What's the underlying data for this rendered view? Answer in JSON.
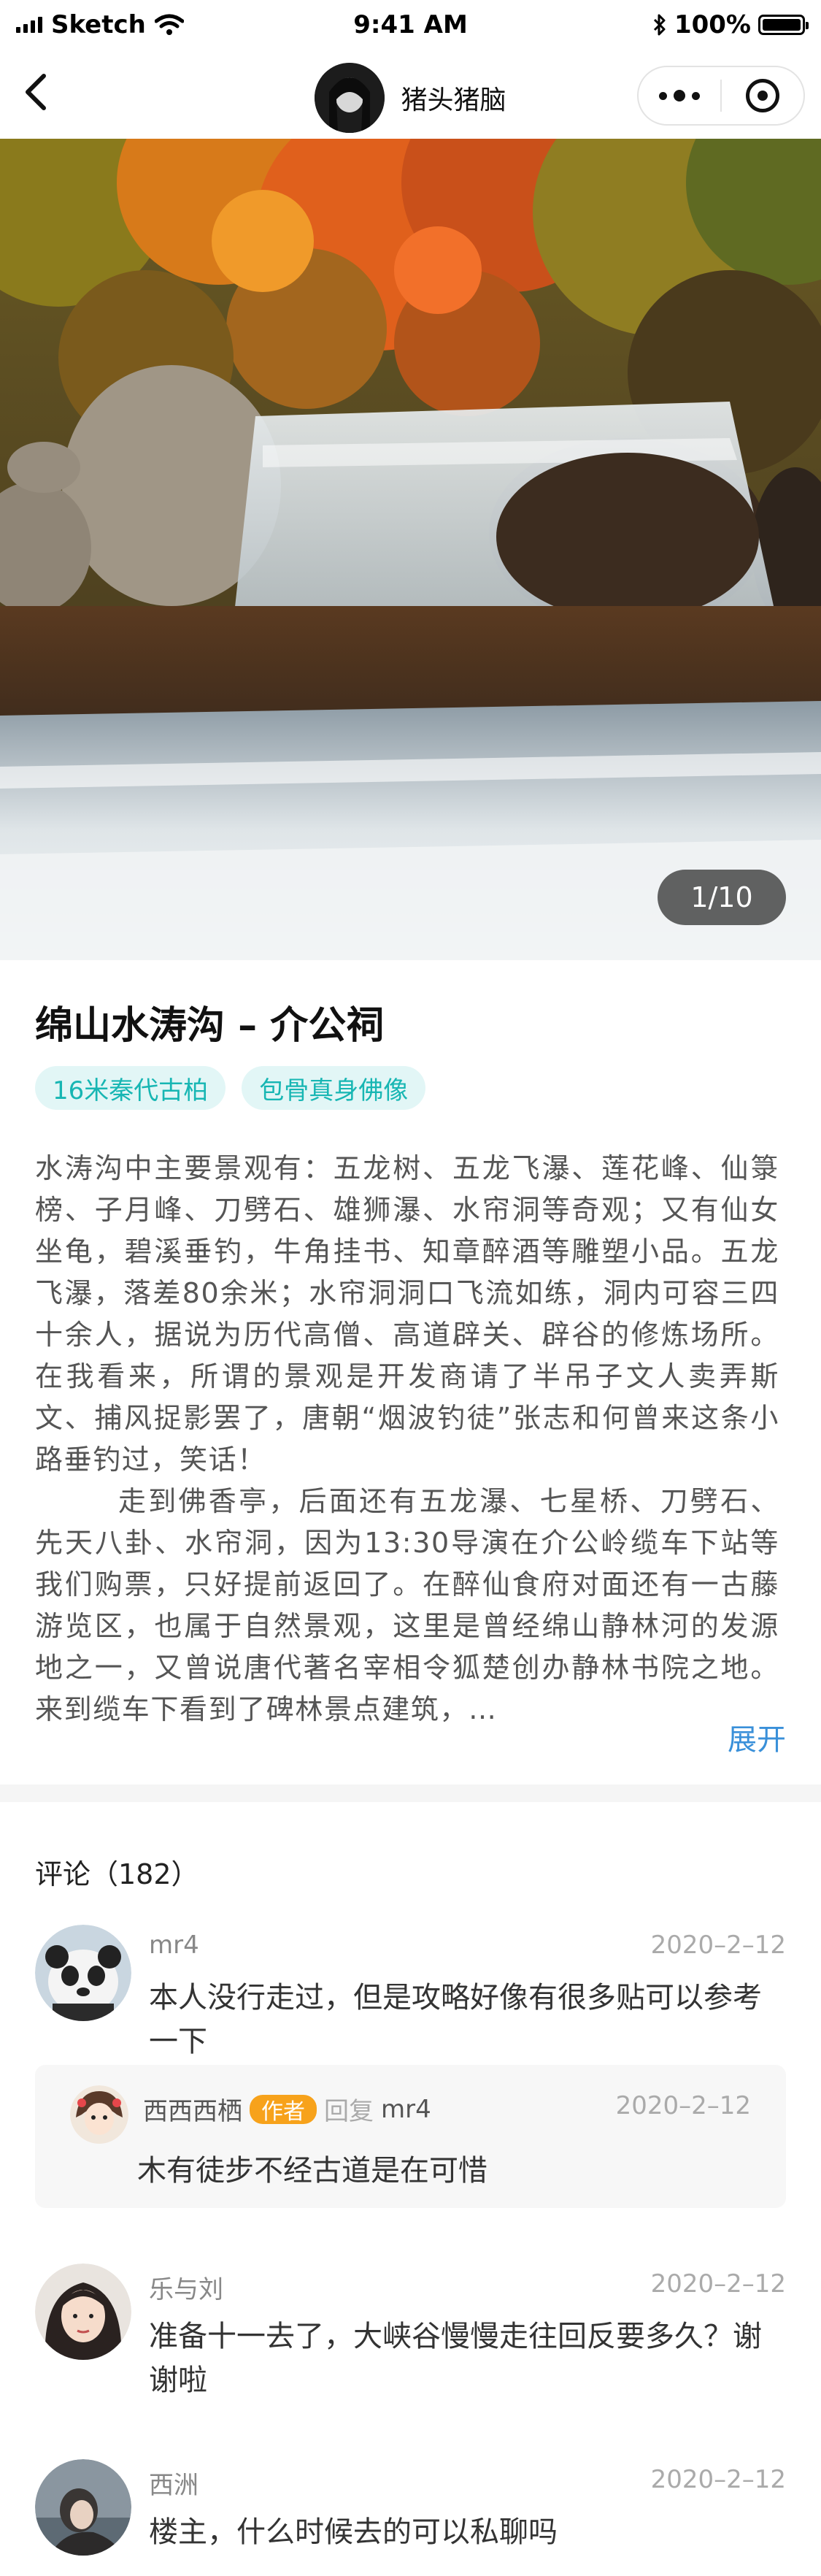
{
  "status_bar": {
    "carrier": "Sketch",
    "time": "9:41 AM",
    "battery": "100%",
    "battery_level": 1.0
  },
  "nav": {
    "title": "猪头猪脑",
    "back_icon": "chevron-left-icon",
    "menu_icon": "more-dots-icon",
    "close_icon": "target-circle-icon"
  },
  "gallery": {
    "counter": "1/10",
    "current": 1,
    "total": 10
  },
  "article": {
    "title": "绵山水涛沟 – 介公祠",
    "tags": [
      "16米秦代古柏",
      "包骨真身佛像"
    ],
    "paragraphs": [
      "水涛沟中主要景观有：五龙树、五龙飞瀑、莲花峰、仙箓榜、子月峰、刀劈石、雄狮瀑、水帘洞等奇观；又有仙女坐龟，碧溪垂钓，牛角挂书、知章醉酒等雕塑小品。五龙飞瀑，落差80余米；水帘洞洞口飞流如练，洞内可容三四十余人，据说为历代高僧、高道辟关、辟谷的修炼场所。在我看来，所谓的景观是开发商请了半吊子文人卖弄斯文、捕风捉影罢了，唐朝“烟波钓徒”张志和何曾来这条小路垂钓过，笑话！",
      "走到佛香亭，后面还有五龙瀑、七星桥、刀劈石、先天八卦、水帘洞，因为13:30导演在介公岭缆车下站等我们购票，只好提前返回了。在醉仙食府对面还有一古藤游览区，也属于自然景观，这里是曾经绵山静林河的发源地之一，又曾说唐代著名宰相令狐楚创办静林书院之地。来到缆车下看到了碑林景点建筑，…"
    ],
    "expand_label": "展开"
  },
  "comments": {
    "header": "评论（182）",
    "items": [
      {
        "name": "mr4",
        "date": "2020–2–12",
        "text": "本人没行走过，但是攻略好像有很多贴可以参考一下",
        "reply": {
          "name": "西西西栖",
          "badge": "作者",
          "label": "回复",
          "target": "mr4",
          "date": "2020–2–12",
          "text": "木有徒步不经古道是在可惜"
        }
      },
      {
        "name": "乐与刘",
        "date": "2020–2–12",
        "text": "准备十一去了，大峡谷慢慢走往回反要多久？谢谢啦"
      },
      {
        "name": "西洲",
        "date": "2020–2–12",
        "text": "楼主，什么时候去的可以私聊吗"
      }
    ]
  }
}
